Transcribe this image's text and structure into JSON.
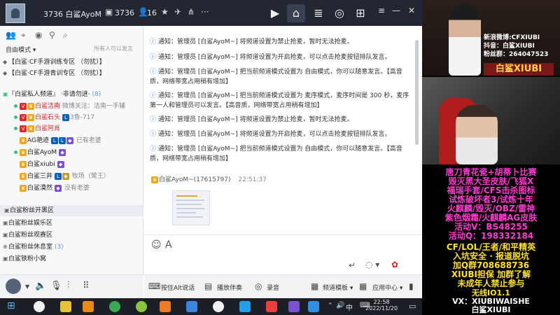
{
  "topbar": {
    "channel_id_title": "3736 白鲨AyoM",
    "channel_num": "3736",
    "online_count": "16"
  },
  "left": {
    "mode_label": "自由模式",
    "mode_hint": "所有人可以发言",
    "channels": [
      {
        "label": "【白鲨·CF手游训练专区  （勿扰）】"
      },
      {
        "label": "【白鲨·CF手游青训专区  （勿扰）】"
      },
      {
        "label": "『白鲨私人频道』    ·非请勿进·",
        "count": "(8)"
      }
    ],
    "users": [
      {
        "name": "白鲨洁南",
        "note": "微博关注：洁南一手辅"
      },
      {
        "name": "白鲨石头",
        "note": "3鱼-717"
      },
      {
        "name": "白鲨阿肖",
        "note": ""
      },
      {
        "name": "AG艳迹",
        "note": "已有老婆"
      },
      {
        "name": "白鲨AyoM",
        "note": ""
      },
      {
        "name": "白鲨xiubi",
        "note": ""
      },
      {
        "name": "白鲨三井",
        "note": "牧场（鹭王）"
      },
      {
        "name": "白鲨漠然",
        "note": "没有老婆"
      }
    ],
    "groups": [
      {
        "label": "白鲨粉丝开黑区"
      },
      {
        "label": "白鲨粉丝娱乐区"
      },
      {
        "label": "白鲨粉丝观赛区"
      },
      {
        "label": "白鲨粉丝休息室",
        "count": "(3)"
      },
      {
        "label": "白鲨铁粉小窝"
      }
    ]
  },
  "chat": {
    "messages": [
      "通知：管理员 [白鲨AyoM~] 将频道设置为禁止抢麦，暂时无法抢麦。",
      "通知：管理员 [白鲨AyoM~] 将频道设置为开启抢麦，可以点击抢麦按钮排队发言。",
      "通知：管理员 [白鲨AyoM~] 把当前频道模式设置为 自由模式，你可以随意发言。【高音质，网络带宽占用稍有增加】",
      "通知：管理员 [白鲨AyoM~] 把当前频道模式设置为 麦序模式，麦序时间是 300 秒，麦序第一人和管理员可以发言。【高音质，网络带宽占用稍有增加】",
      "通知：管理员 [白鲨AyoM~] 将频道设置为禁止抢麦，暂时无法抢麦。",
      "通知：管理员 [白鲨AyoM~] 将频道设置为开启抢麦，可以点击抢麦按钮排队发言。",
      "通知：管理员 [白鲨AyoM~] 把当前频道模式设置为 自由模式，你可以随意发言。【高音质，网络带宽占用稍有增加】"
    ],
    "sender": "白鲨AyoM~(17615797)",
    "sender_time": "22:51:37"
  },
  "bottombar": {
    "ptt_label": "按住Alt说话",
    "play_label": "播放伴奏",
    "record_label": "录音",
    "template_label": "频道模板",
    "app_center_label": "应用中心"
  },
  "overlay": {
    "weibo": "新浪微博:CFXIUBI",
    "douyin": "抖音：白鲨XIUBI",
    "fans": "粉丝群：264047523",
    "name_plate": "白鲨XIUBI",
    "promo_lines_pink": [
      "唐刀青花瓷+胡蒂卜比赛",
      "毁灭黑大圣皮肤/飞狐X",
      "福瑞手套/CFS击杀图标",
      "试炼破坏者3/试炼十年",
      "火麒麟/毁灭/OBZ/雷神",
      "紫色烟霜/火麒麟AG皮肤",
      "活动V：BS48255",
      "活动Q：198332184"
    ],
    "promo_lines_yellow": [
      "CF/LOL/王者/和平精英",
      "入坑安全 · 报道脱坑",
      "加Q群708688736",
      "XIUBI担保  加群了解",
      "未成年人禁止参与"
    ],
    "footer_lines": [
      "无线IO1.1",
      "VX：XIUBIWAISHE",
      "白鲨XIUBI"
    ]
  },
  "taskbar": {
    "ime": "中",
    "time": "22:58",
    "date": "2022/11/20"
  }
}
